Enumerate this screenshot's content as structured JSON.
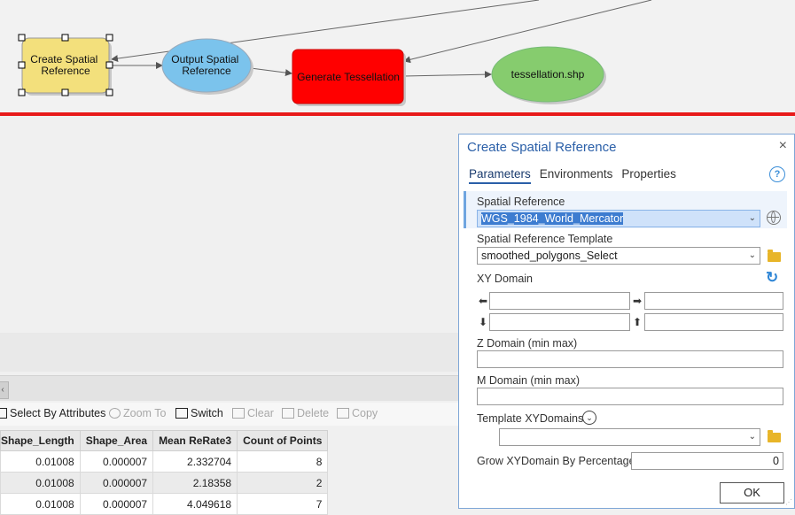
{
  "model": {
    "nodes": {
      "create_sr": "Create Spatial\nReference",
      "output_sr": "Output Spatial\nReference",
      "gen_tess": "Generate Tessellation",
      "tess_shp": "tessellation.shp"
    },
    "colors": {
      "tool": "#f3e07c",
      "tool_selected_border": "#000000",
      "data_blue": "#7bc3ec",
      "tool_red": "#ff0000",
      "output_green": "#86cc6e",
      "divider": "#e81a1a"
    }
  },
  "toolbar": {
    "items": [
      {
        "label": "Select By Attributes",
        "icon": "table-select-icon",
        "enabled": true
      },
      {
        "label": "Zoom To",
        "icon": "zoom-icon",
        "enabled": false
      },
      {
        "label": "Switch",
        "icon": "switch-icon",
        "enabled": true
      },
      {
        "label": "Clear",
        "icon": "clear-icon",
        "enabled": false
      },
      {
        "label": "Delete",
        "icon": "delete-icon",
        "enabled": false
      },
      {
        "label": "Copy",
        "icon": "copy-icon",
        "enabled": false
      }
    ]
  },
  "table": {
    "columns": [
      "Shape_Length",
      "Shape_Area",
      "Mean ReRate3",
      "Count of Points"
    ],
    "rows": [
      [
        "0.01008",
        "0.000007",
        "2.332704",
        "8"
      ],
      [
        "0.01008",
        "0.000007",
        "2.18358",
        "2"
      ],
      [
        "0.01008",
        "0.000007",
        "4.049618",
        "7"
      ]
    ]
  },
  "dialog": {
    "title": "Create Spatial Reference",
    "close": "×",
    "tabs": [
      "Parameters",
      "Environments",
      "Properties"
    ],
    "help": "?",
    "params": {
      "spatial_reference_label": "Spatial Reference",
      "spatial_reference_value": "WGS_1984_World_Mercator",
      "template_label": "Spatial Reference Template",
      "template_value": "smoothed_polygons_Select",
      "xy_domain_label": "XY Domain",
      "z_domain_label": "Z Domain (min max)",
      "m_domain_label": "M Domain (min max)",
      "template_xy_label": "Template XYDomains",
      "template_xy_value": "",
      "grow_label": "Grow XYDomain By Percentage",
      "grow_value": "0"
    },
    "ok_label": "OK"
  }
}
